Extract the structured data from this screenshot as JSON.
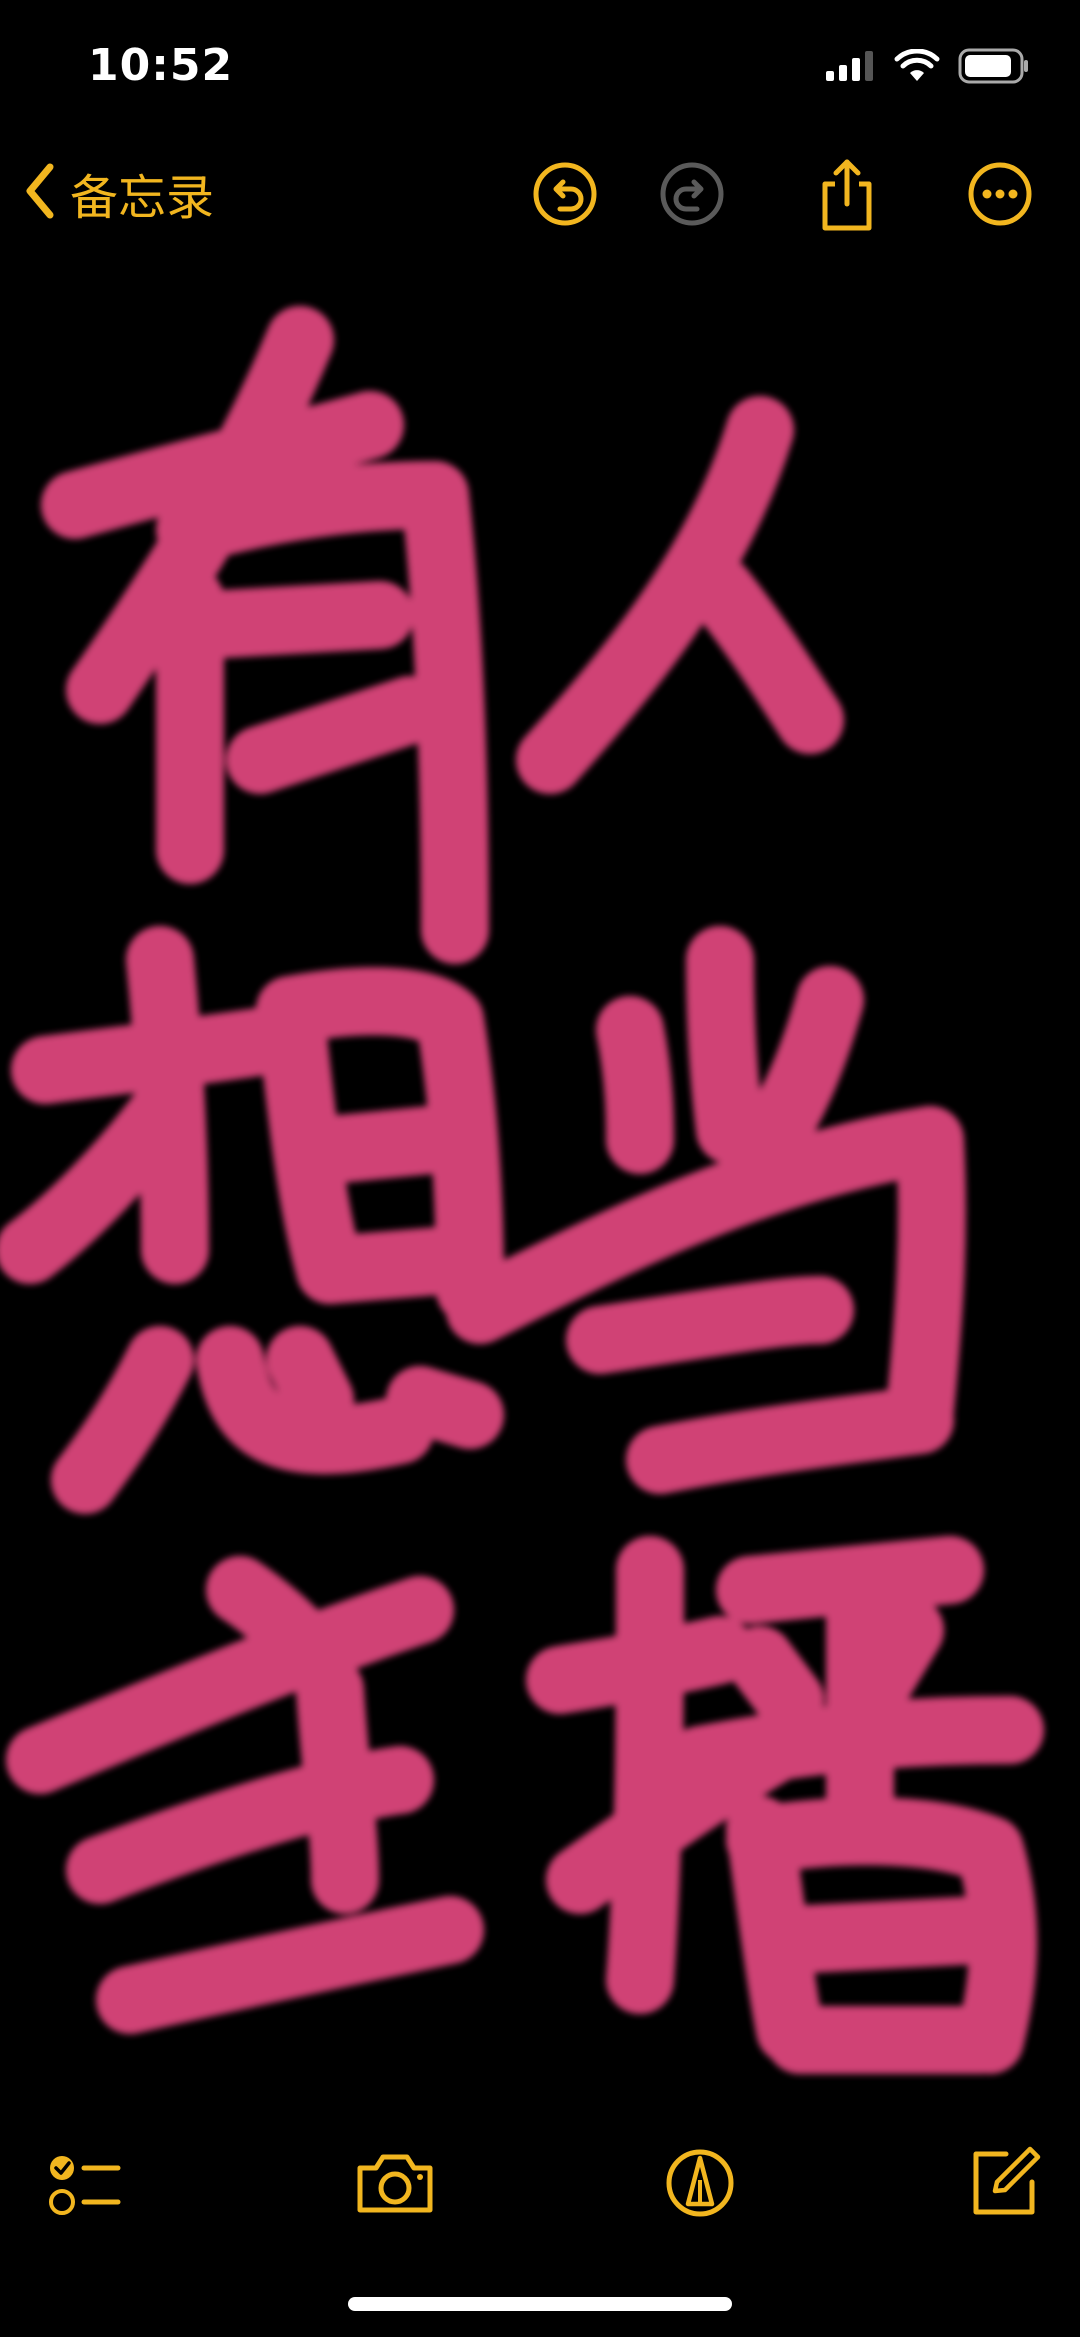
{
  "status_bar": {
    "time": "10:52",
    "battery_level": 0.85,
    "icons": [
      "cellular-signal-icon",
      "wifi-icon",
      "battery-icon"
    ]
  },
  "nav": {
    "back_label": "备忘录",
    "actions": [
      "undo-icon",
      "redo-icon",
      "share-icon",
      "more-icon"
    ],
    "redo_enabled": false
  },
  "note": {
    "handwriting": "有人想当主播",
    "ink_color": "#e0467e"
  },
  "toolbar": {
    "items": [
      "checklist-icon",
      "camera-icon",
      "markup-pen-icon",
      "compose-icon"
    ]
  },
  "colors": {
    "accent": "#f2b61f",
    "background": "#000000",
    "ink": "#e0467e",
    "disabled": "#5a5a5a"
  }
}
